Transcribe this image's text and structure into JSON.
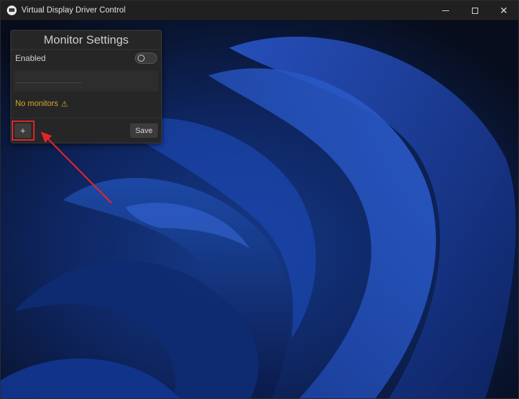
{
  "window": {
    "title": "Virtual Display Driver Control",
    "controls": {
      "minimize": "minimize-icon",
      "maximize": "maximize-icon",
      "close": "close-icon",
      "close_glyph": "✕"
    }
  },
  "panel": {
    "title": "Monitor Settings",
    "enabled_label": "Enabled",
    "enabled": false,
    "status_text": "No monitors",
    "warning_glyph": "⚠",
    "add_label": "+",
    "save_label": "Save"
  },
  "annotation": {
    "highlight_color": "#e0262a",
    "target": "add-monitor-button"
  },
  "colors": {
    "accent": "#d4a72c",
    "wallpaper_base": "#0b1e4a"
  }
}
